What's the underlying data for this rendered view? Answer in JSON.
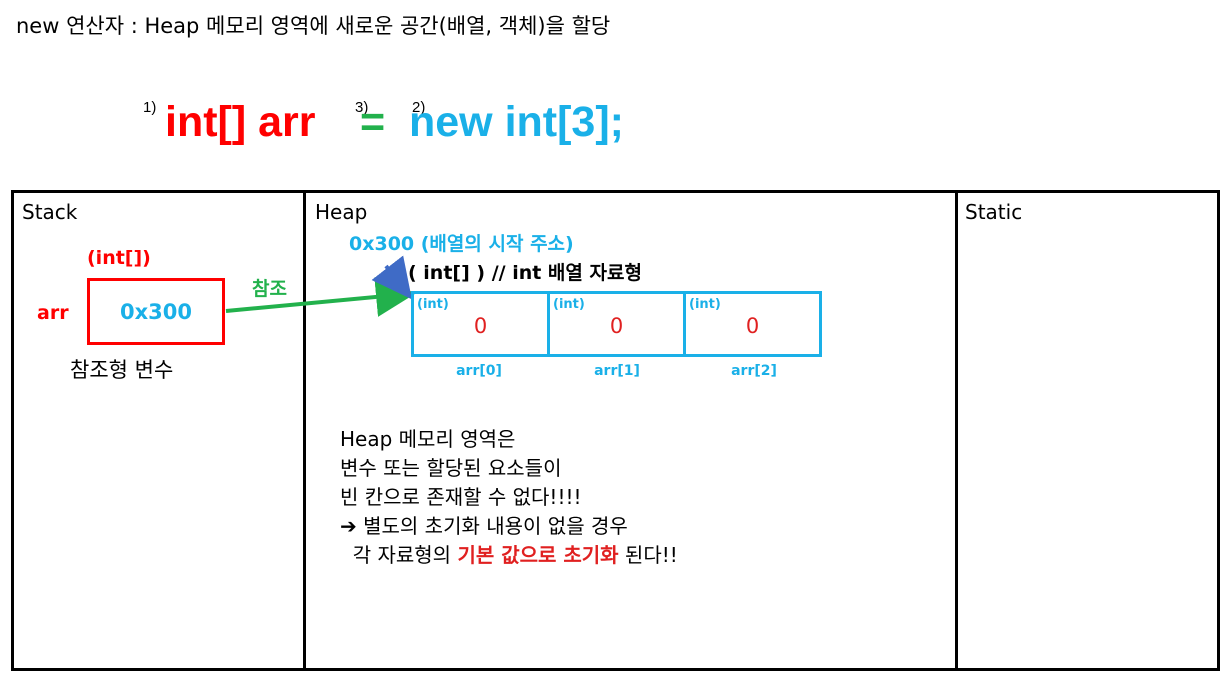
{
  "title": "new 연산자 : Heap 메모리 영역에 새로운 공간(배열, 객체)을 할당",
  "code": {
    "step1": "1)",
    "declaration": "int[] arr",
    "step3": "3)",
    "assign": "=",
    "step2": "2)",
    "allocation": "new int[3];"
  },
  "memory": {
    "stack": {
      "label": "Stack",
      "ref_type": "(int[])",
      "var_name": "arr",
      "ref_value": "0x300",
      "caption": "참조형 변수",
      "arrow_label": "참조"
    },
    "heap": {
      "label": "Heap",
      "address_note": "0x300 (배열의 시작 주소)",
      "type_note": "( int[] )  // int 배열 자료형",
      "cells": [
        {
          "type": "(int)",
          "value": "0",
          "index": "arr[0]"
        },
        {
          "type": "(int)",
          "value": "0",
          "index": "arr[1]"
        },
        {
          "type": "(int)",
          "value": "0",
          "index": "arr[2]"
        }
      ],
      "note": {
        "line1": "Heap 메모리 영역은",
        "line2": "변수 또는 할당된 요소들이",
        "line3": "빈 칸으로 존재할 수 없다!!!!",
        "line4_arrow": "➔",
        "line4": " 별도의 초기화 내용이 없을 경우",
        "line5_pre": "  각 자료형의 ",
        "line5_emph": "기본 값으로 초기화",
        "line5_post": " 된다!!"
      }
    },
    "static": {
      "label": "Static"
    }
  },
  "colors": {
    "declaration": "#ff0000",
    "assign": "#22b14c",
    "allocation": "#1ab0e8",
    "emphasis": "#e02020"
  }
}
